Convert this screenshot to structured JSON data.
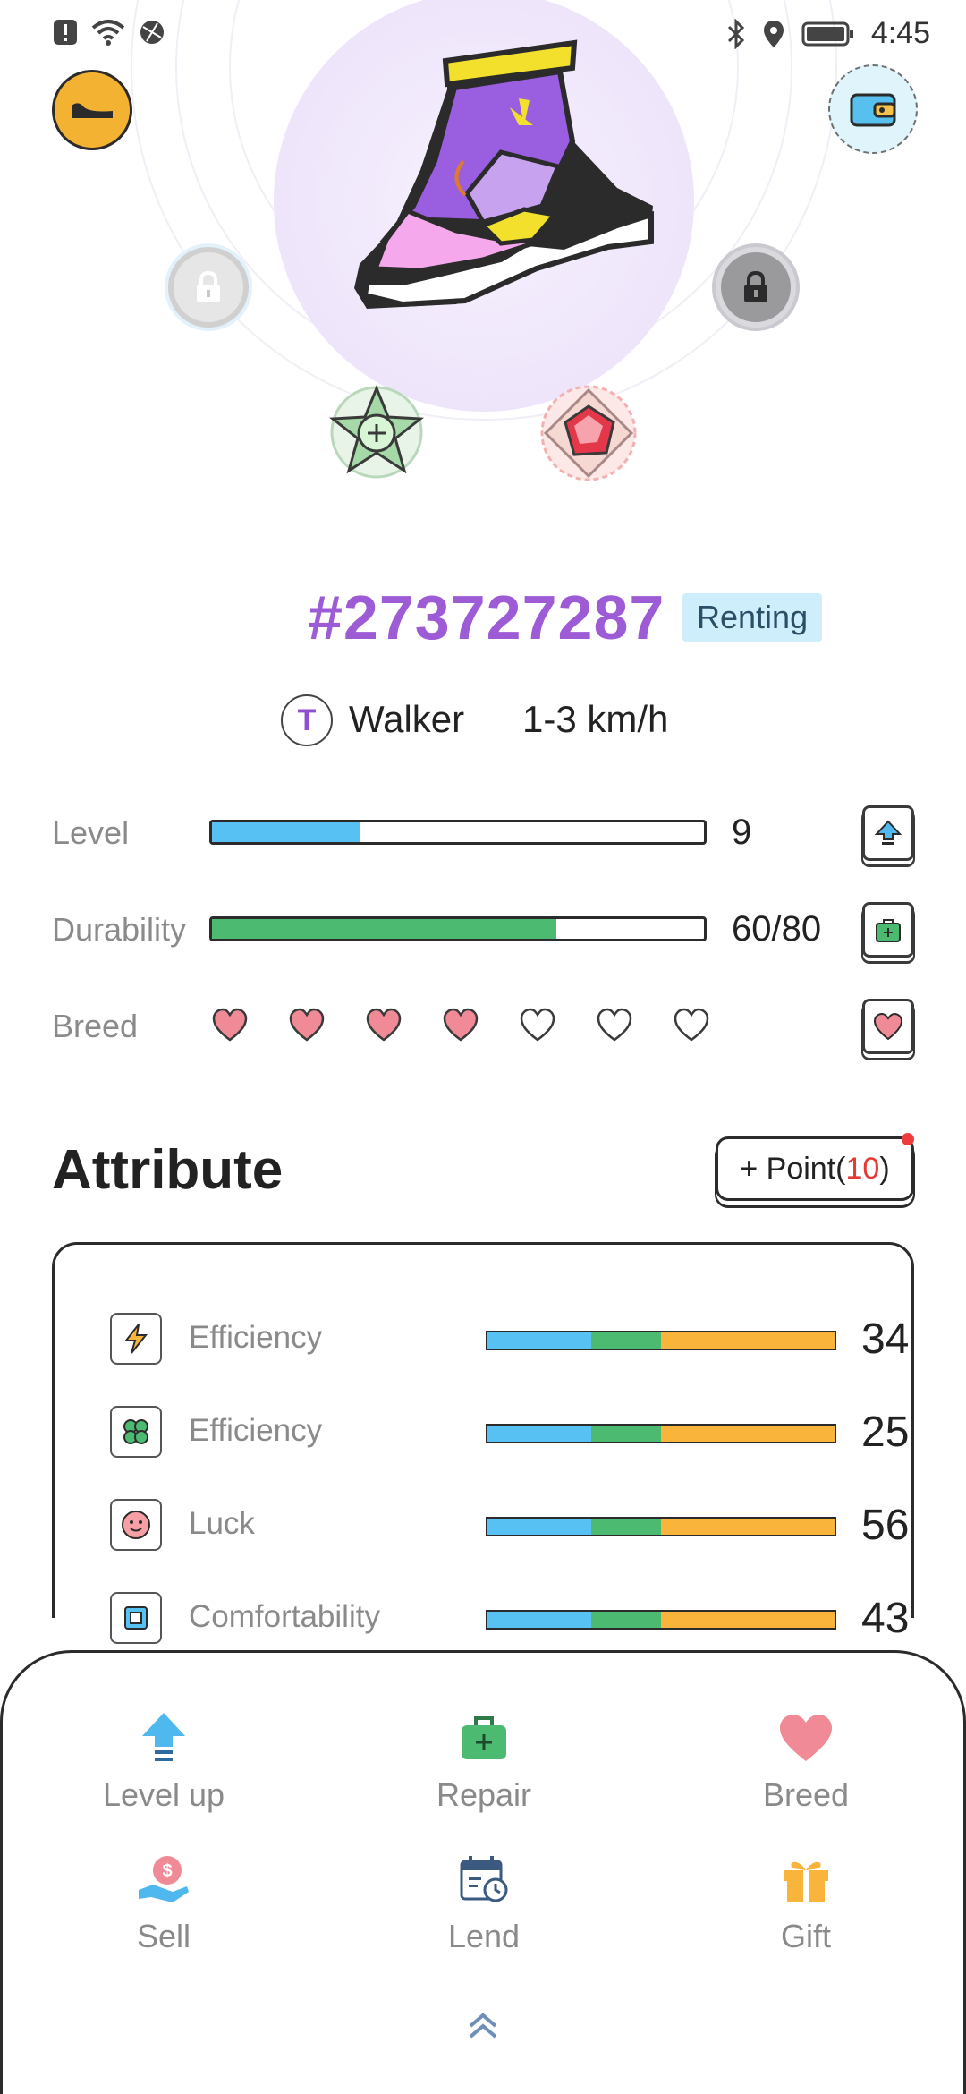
{
  "status_bar": {
    "time": "4:45",
    "left_icons": [
      "alert-icon",
      "wifi-icon",
      "data-icon"
    ],
    "right_icons": [
      "bluetooth-icon",
      "location-icon",
      "battery-icon"
    ]
  },
  "hero": {
    "back_icon": "shoe-back-icon",
    "wallet_icon": "wallet-icon",
    "slots": [
      "lock-icon",
      "lock-icon",
      "star-badge-icon",
      "gem-badge-icon"
    ]
  },
  "shoe": {
    "id": "#273727287",
    "status": "Renting",
    "type_letter": "T",
    "type": "Walker",
    "speed": "1-3 km/h"
  },
  "stats": {
    "level_label": "Level",
    "level_value": "9",
    "level_fraction": 0.3,
    "durability_label": "Durability",
    "durability_value": "60/80",
    "durability_fraction": 0.7,
    "breed_label": "Breed",
    "breed_filled": 4,
    "breed_total": 7
  },
  "attribute": {
    "title": "Attribute",
    "point_prefix": "+ Point(",
    "point_count": "10",
    "point_suffix": ")",
    "rows": [
      {
        "label": "Efficiency",
        "value": "34",
        "icon": "lightning-icon"
      },
      {
        "label": "Efficiency",
        "value": "25",
        "icon": "clover-icon"
      },
      {
        "label": "Luck",
        "value": "56",
        "icon": "smile-icon"
      },
      {
        "label": "Comfortability",
        "value": "43",
        "icon": "chip-icon"
      }
    ]
  },
  "actions": {
    "level_up": "Level up",
    "repair": "Repair",
    "breed": "Breed",
    "sell": "Sell",
    "lend": "Lend",
    "gift": "Gift"
  },
  "colors": {
    "accent_purple": "#9d5cd6",
    "level_bar": "#56c1f2",
    "durability_bar": "#4cba70",
    "heart": "#f08a96",
    "seg_blue": "#56c1f2",
    "seg_green": "#4cba70",
    "seg_orange": "#f9b43c"
  }
}
